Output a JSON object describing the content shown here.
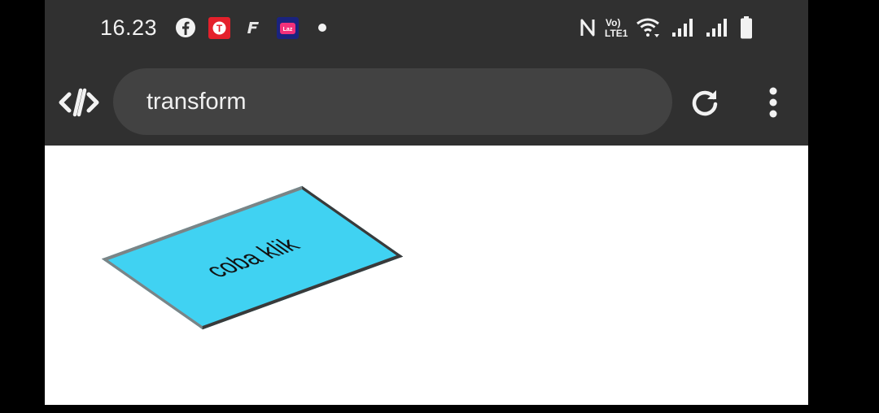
{
  "status_bar": {
    "time": "16.23",
    "notification_icons": [
      "facebook-icon",
      "telkomsel-app-icon",
      "f-app-icon",
      "lazada-app-icon",
      "dot-icon"
    ],
    "right_icons": [
      "nfc-icon",
      "volte-icon",
      "wifi-icon",
      "signal-1-icon",
      "signal-2-icon",
      "battery-icon"
    ],
    "volte_label": "Vo)\nLTE1"
  },
  "toolbar": {
    "url": "transform"
  },
  "content": {
    "box_label": "coba klik"
  },
  "colors": {
    "bar_bg": "#303030",
    "url_bg": "#424242",
    "box_fill": "#40d2f2"
  }
}
